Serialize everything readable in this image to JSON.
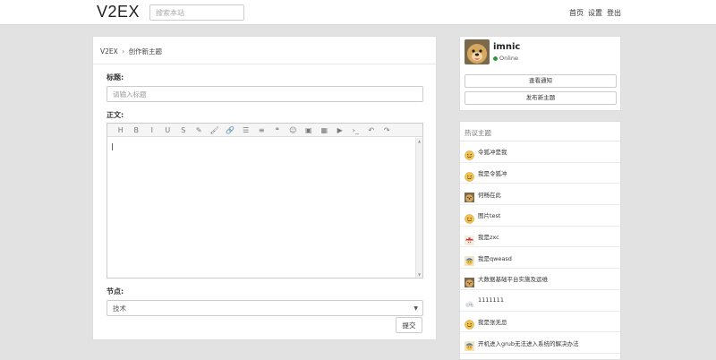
{
  "header": {
    "logo": "V2EX",
    "search_placeholder": "搜索本站",
    "nav": [
      "首页",
      "设置",
      "登出"
    ]
  },
  "breadcrumb": {
    "home": "V2EX",
    "separator": "›",
    "current": "创作新主题"
  },
  "form": {
    "title_label": "标题:",
    "title_placeholder": "请输入标题",
    "body_label": "正文:",
    "node_label": "节点:",
    "node_selected": "技术",
    "submit_label": "提交"
  },
  "toolbar_icons": [
    "heading-icon",
    "bold-icon",
    "italic-icon",
    "underline-icon",
    "strikethrough-icon",
    "pen-icon",
    "brush-icon",
    "link-icon",
    "unordered-list-icon",
    "align-icon",
    "quote-icon",
    "emoji-icon",
    "image-icon",
    "table-icon",
    "video-icon",
    "code-icon",
    "undo-icon",
    "redo-icon"
  ],
  "toolbar_glyphs": [
    "H",
    "B",
    "I",
    "U",
    "S",
    "✎",
    "🖌",
    "🔗",
    "☰",
    "≡",
    "❝",
    "☺",
    "▣",
    "▦",
    "▶",
    "›_",
    "↶",
    "↷"
  ],
  "profile": {
    "username": "imnic",
    "status": "Online",
    "status_color": "#2e9b3a",
    "notifications_button": "查看通知",
    "new_topic_button": "发布新主题"
  },
  "hot_topics": {
    "title": "热议主题",
    "items": [
      {
        "title": "令狐冲是我",
        "avatar": "smiley"
      },
      {
        "title": "我是令狐冲",
        "avatar": "smiley"
      },
      {
        "title": "何畅在此",
        "avatar": "dog"
      },
      {
        "title": "图片test",
        "avatar": "smiley"
      },
      {
        "title": "我是zxc",
        "avatar": "mushroom"
      },
      {
        "title": "我是qweasd",
        "avatar": "cap"
      },
      {
        "title": "大数据基础平台实施及运维",
        "avatar": "dog"
      },
      {
        "title": "1111111",
        "avatar": "cloud"
      },
      {
        "title": "我是张无忌",
        "avatar": "smiley"
      },
      {
        "title": "开机进入grub无法进入系统的解决办法",
        "avatar": "cap"
      }
    ]
  }
}
